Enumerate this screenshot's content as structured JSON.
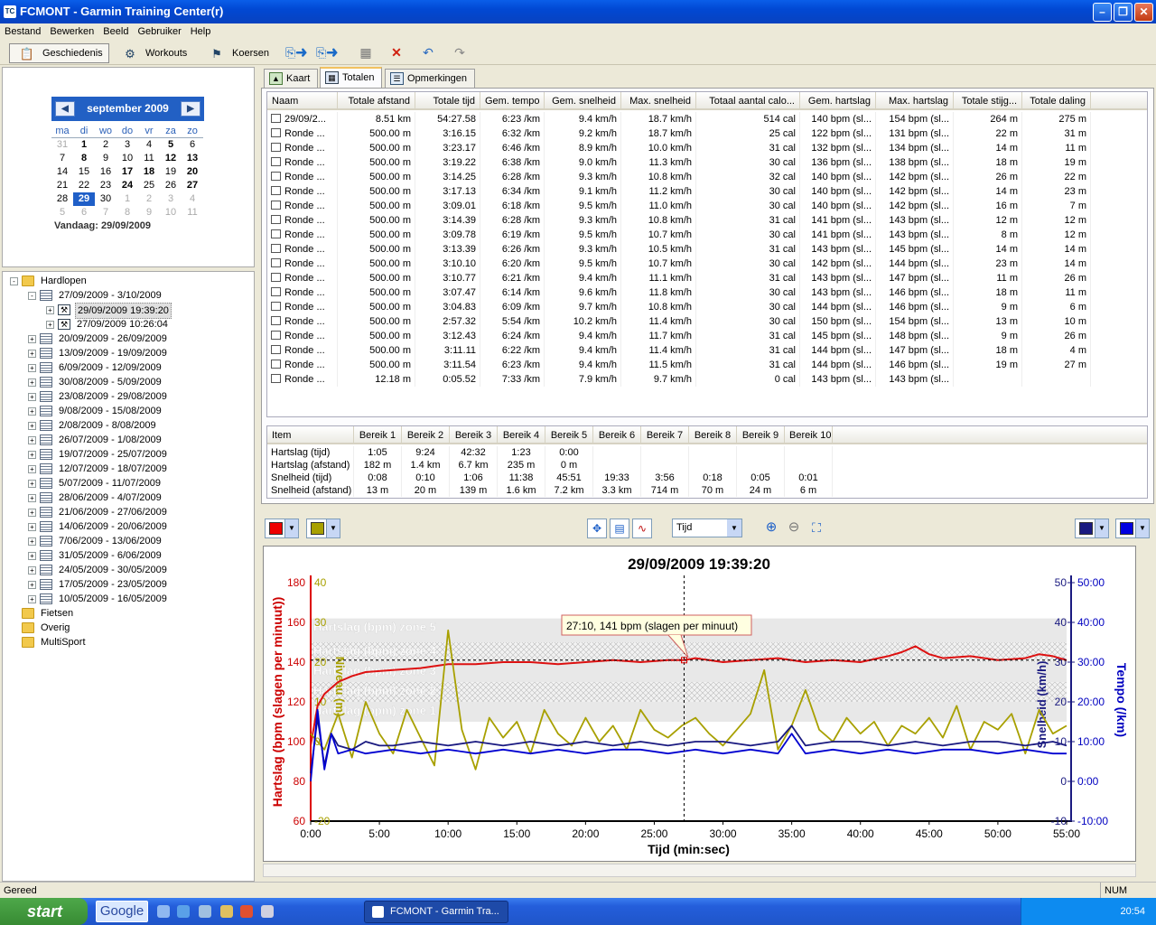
{
  "window": {
    "title": "FCMONT - Garmin Training Center(r)",
    "app_icon": "TC"
  },
  "menu": [
    "Bestand",
    "Bewerken",
    "Beeld",
    "Gebruiker",
    "Help"
  ],
  "toolbar": {
    "geschiedenis": "Geschiedenis",
    "workouts": "Workouts",
    "koersen": "Koersen"
  },
  "calendar": {
    "month": "september 2009",
    "weekdays": [
      "ma",
      "di",
      "wo",
      "do",
      "vr",
      "za",
      "zo"
    ],
    "weeks": [
      [
        "31",
        "1",
        "2",
        "3",
        "4",
        "5",
        "6"
      ],
      [
        "7",
        "8",
        "9",
        "10",
        "11",
        "12",
        "13"
      ],
      [
        "14",
        "15",
        "16",
        "17",
        "18",
        "19",
        "20"
      ],
      [
        "21",
        "22",
        "23",
        "24",
        "25",
        "26",
        "27"
      ],
      [
        "28",
        "29",
        "30",
        "1",
        "2",
        "3",
        "4"
      ],
      [
        "5",
        "6",
        "7",
        "8",
        "9",
        "10",
        "11"
      ]
    ],
    "today": "Vandaag: 29/09/2009"
  },
  "tree": [
    {
      "label": "Hardlopen",
      "level": 0,
      "type": "folder",
      "exp": "-"
    },
    {
      "label": "27/09/2009 - 3/10/2009",
      "level": 1,
      "type": "week",
      "exp": "-"
    },
    {
      "label": "29/09/2009 19:39:20",
      "level": 2,
      "type": "act",
      "exp": "+",
      "selected": true
    },
    {
      "label": "27/09/2009 10:26:04",
      "level": 2,
      "type": "act",
      "exp": "+"
    },
    {
      "label": "20/09/2009 - 26/09/2009",
      "level": 1,
      "type": "week",
      "exp": "+"
    },
    {
      "label": "13/09/2009 - 19/09/2009",
      "level": 1,
      "type": "week",
      "exp": "+"
    },
    {
      "label": "6/09/2009 - 12/09/2009",
      "level": 1,
      "type": "week",
      "exp": "+"
    },
    {
      "label": "30/08/2009 - 5/09/2009",
      "level": 1,
      "type": "week",
      "exp": "+"
    },
    {
      "label": "23/08/2009 - 29/08/2009",
      "level": 1,
      "type": "week",
      "exp": "+"
    },
    {
      "label": "9/08/2009 - 15/08/2009",
      "level": 1,
      "type": "week",
      "exp": "+"
    },
    {
      "label": "2/08/2009 - 8/08/2009",
      "level": 1,
      "type": "week",
      "exp": "+"
    },
    {
      "label": "26/07/2009 - 1/08/2009",
      "level": 1,
      "type": "week",
      "exp": "+"
    },
    {
      "label": "19/07/2009 - 25/07/2009",
      "level": 1,
      "type": "week",
      "exp": "+"
    },
    {
      "label": "12/07/2009 - 18/07/2009",
      "level": 1,
      "type": "week",
      "exp": "+"
    },
    {
      "label": "5/07/2009 - 11/07/2009",
      "level": 1,
      "type": "week",
      "exp": "+"
    },
    {
      "label": "28/06/2009 - 4/07/2009",
      "level": 1,
      "type": "week",
      "exp": "+"
    },
    {
      "label": "21/06/2009 - 27/06/2009",
      "level": 1,
      "type": "week",
      "exp": "+"
    },
    {
      "label": "14/06/2009 - 20/06/2009",
      "level": 1,
      "type": "week",
      "exp": "+"
    },
    {
      "label": "7/06/2009 - 13/06/2009",
      "level": 1,
      "type": "week",
      "exp": "+"
    },
    {
      "label": "31/05/2009 - 6/06/2009",
      "level": 1,
      "type": "week",
      "exp": "+"
    },
    {
      "label": "24/05/2009 - 30/05/2009",
      "level": 1,
      "type": "week",
      "exp": "+"
    },
    {
      "label": "17/05/2009 - 23/05/2009",
      "level": 1,
      "type": "week",
      "exp": "+"
    },
    {
      "label": "10/05/2009 - 16/05/2009",
      "level": 1,
      "type": "week",
      "exp": "+"
    },
    {
      "label": "Fietsen",
      "level": 0,
      "type": "folder",
      "exp": ""
    },
    {
      "label": "Overig",
      "level": 0,
      "type": "folder",
      "exp": ""
    },
    {
      "label": "MultiSport",
      "level": 0,
      "type": "folder",
      "exp": ""
    }
  ],
  "tabs": [
    "Kaart",
    "Totalen",
    "Opmerkingen"
  ],
  "laps": {
    "columns": [
      "Naam",
      "Totale afstand",
      "Totale tijd",
      "Gem. tempo",
      "Gem. snelheid",
      "Max. snelheid",
      "Totaal aantal calo...",
      "Gem. hartslag",
      "Max. hartslag",
      "Totale stijg...",
      "Totale daling"
    ],
    "rows": [
      [
        "29/09/2...",
        "8.51 km",
        "54:27.58",
        "6:23 /km",
        "9.4 km/h",
        "18.7 km/h",
        "514 cal",
        "140 bpm (sl...",
        "154 bpm (sl...",
        "264 m",
        "275 m"
      ],
      [
        "Ronde ...",
        "500.00 m",
        "3:16.15",
        "6:32 /km",
        "9.2 km/h",
        "18.7 km/h",
        "25 cal",
        "122 bpm (sl...",
        "131 bpm (sl...",
        "22 m",
        "31 m"
      ],
      [
        "Ronde ...",
        "500.00 m",
        "3:23.17",
        "6:46 /km",
        "8.9 km/h",
        "10.0 km/h",
        "31 cal",
        "132 bpm (sl...",
        "134 bpm (sl...",
        "14 m",
        "11 m"
      ],
      [
        "Ronde ...",
        "500.00 m",
        "3:19.22",
        "6:38 /km",
        "9.0 km/h",
        "11.3 km/h",
        "30 cal",
        "136 bpm (sl...",
        "138 bpm (sl...",
        "18 m",
        "19 m"
      ],
      [
        "Ronde ...",
        "500.00 m",
        "3:14.25",
        "6:28 /km",
        "9.3 km/h",
        "10.8 km/h",
        "32 cal",
        "140 bpm (sl...",
        "142 bpm (sl...",
        "26 m",
        "22 m"
      ],
      [
        "Ronde ...",
        "500.00 m",
        "3:17.13",
        "6:34 /km",
        "9.1 km/h",
        "11.2 km/h",
        "30 cal",
        "140 bpm (sl...",
        "142 bpm (sl...",
        "14 m",
        "23 m"
      ],
      [
        "Ronde ...",
        "500.00 m",
        "3:09.01",
        "6:18 /km",
        "9.5 km/h",
        "11.0 km/h",
        "30 cal",
        "140 bpm (sl...",
        "142 bpm (sl...",
        "16 m",
        "7 m"
      ],
      [
        "Ronde ...",
        "500.00 m",
        "3:14.39",
        "6:28 /km",
        "9.3 km/h",
        "10.8 km/h",
        "31 cal",
        "141 bpm (sl...",
        "143 bpm (sl...",
        "12 m",
        "12 m"
      ],
      [
        "Ronde ...",
        "500.00 m",
        "3:09.78",
        "6:19 /km",
        "9.5 km/h",
        "10.7 km/h",
        "30 cal",
        "141 bpm (sl...",
        "143 bpm (sl...",
        "8 m",
        "12 m"
      ],
      [
        "Ronde ...",
        "500.00 m",
        "3:13.39",
        "6:26 /km",
        "9.3 km/h",
        "10.5 km/h",
        "31 cal",
        "143 bpm (sl...",
        "145 bpm (sl...",
        "14 m",
        "14 m"
      ],
      [
        "Ronde ...",
        "500.00 m",
        "3:10.10",
        "6:20 /km",
        "9.5 km/h",
        "10.7 km/h",
        "30 cal",
        "142 bpm (sl...",
        "144 bpm (sl...",
        "23 m",
        "14 m"
      ],
      [
        "Ronde ...",
        "500.00 m",
        "3:10.77",
        "6:21 /km",
        "9.4 km/h",
        "11.1 km/h",
        "31 cal",
        "143 bpm (sl...",
        "147 bpm (sl...",
        "11 m",
        "26 m"
      ],
      [
        "Ronde ...",
        "500.00 m",
        "3:07.47",
        "6:14 /km",
        "9.6 km/h",
        "11.8 km/h",
        "30 cal",
        "143 bpm (sl...",
        "146 bpm (sl...",
        "18 m",
        "11 m"
      ],
      [
        "Ronde ...",
        "500.00 m",
        "3:04.83",
        "6:09 /km",
        "9.7 km/h",
        "10.8 km/h",
        "30 cal",
        "144 bpm (sl...",
        "146 bpm (sl...",
        "9 m",
        "6 m"
      ],
      [
        "Ronde ...",
        "500.00 m",
        "2:57.32",
        "5:54 /km",
        "10.2 km/h",
        "11.4 km/h",
        "30 cal",
        "150 bpm (sl...",
        "154 bpm (sl...",
        "13 m",
        "10 m"
      ],
      [
        "Ronde ...",
        "500.00 m",
        "3:12.43",
        "6:24 /km",
        "9.4 km/h",
        "11.7 km/h",
        "31 cal",
        "145 bpm (sl...",
        "148 bpm (sl...",
        "9 m",
        "26 m"
      ],
      [
        "Ronde ...",
        "500.00 m",
        "3:11.11",
        "6:22 /km",
        "9.4 km/h",
        "11.4 km/h",
        "31 cal",
        "144 bpm (sl...",
        "147 bpm (sl...",
        "18 m",
        "4 m"
      ],
      [
        "Ronde ...",
        "500.00 m",
        "3:11.54",
        "6:23 /km",
        "9.4 km/h",
        "11.5 km/h",
        "31 cal",
        "144 bpm (sl...",
        "146 bpm (sl...",
        "19 m",
        "27 m"
      ],
      [
        "Ronde ...",
        "12.18 m",
        "0:05.52",
        "7:33 /km",
        "7.9 km/h",
        "9.7 km/h",
        "0 cal",
        "143 bpm (sl...",
        "143 bpm (sl...",
        "",
        ""
      ]
    ]
  },
  "zones": {
    "columns": [
      "Item",
      "Bereik 1",
      "Bereik 2",
      "Bereik 3",
      "Bereik 4",
      "Bereik 5",
      "Bereik 6",
      "Bereik 7",
      "Bereik 8",
      "Bereik 9",
      "Bereik 10"
    ],
    "rows": [
      [
        "Hartslag (tijd)",
        "1:05",
        "9:24",
        "42:32",
        "1:23",
        "0:00",
        "",
        "",
        "",
        "",
        ""
      ],
      [
        "Hartslag (afstand)",
        "182 m",
        "1.4 km",
        "6.7 km",
        "235 m",
        "0 m",
        "",
        "",
        "",
        "",
        ""
      ],
      [
        "Snelheid (tijd)",
        "0:08",
        "0:10",
        "1:06",
        "11:38",
        "45:51",
        "19:33",
        "3:56",
        "0:18",
        "0:05",
        "0:01"
      ],
      [
        "Snelheid (afstand)",
        "13 m",
        "20 m",
        "139 m",
        "1.6 km",
        "7.2 km",
        "3.3 km",
        "714 m",
        "70 m",
        "24 m",
        "6 m"
      ]
    ]
  },
  "chart_controls": {
    "x_axis_select": "Tijd",
    "colors": [
      "#ee0000",
      "#a8a000",
      "#1a1a80",
      "#0000e0"
    ]
  },
  "chart_data": {
    "type": "line",
    "title": "29/09/2009 19:39:20",
    "xlabel": "Tijd (min:sec)",
    "xlim": [
      0,
      55
    ],
    "x_ticks": [
      "0:00",
      "5:00",
      "10:00",
      "15:00",
      "20:00",
      "25:00",
      "30:00",
      "35:00",
      "40:00",
      "45:00",
      "50:00",
      "55:00"
    ],
    "axes": {
      "left1": {
        "label": "Hartslag (bpm (slagen per minuut))",
        "min": 60,
        "max": 180,
        "ticks": [
          "60",
          "80",
          "100",
          "120",
          "140",
          "160",
          "180"
        ],
        "color": "#cc0000"
      },
      "left2": {
        "label": "Niveau (m)",
        "min": -20,
        "max": 40,
        "ticks": [
          "-20",
          "0",
          "10",
          "20",
          "30",
          "40"
        ],
        "color": "#a8a000"
      },
      "right1": {
        "label": "Snelheid (km/h)",
        "min": -10,
        "max": 50,
        "ticks": [
          "-10",
          "0",
          "10",
          "20",
          "30",
          "40",
          "50"
        ],
        "color": "#1a1a80"
      },
      "right2": {
        "label": "Tempo (/km)",
        "ticks": [
          "-10:00",
          "0:00",
          "10:00",
          "20:00",
          "30:00",
          "40:00",
          "50:00"
        ],
        "color": "#0000c0"
      }
    },
    "zones": [
      {
        "label": "Hartslag (bpm) zone 5",
        "lo": 150,
        "hi": 162
      },
      {
        "label": "Hartslag (bpm) zone 4",
        "lo": 140,
        "hi": 150
      },
      {
        "label": "Hartslag (bpm) zone 3",
        "lo": 130,
        "hi": 140
      },
      {
        "label": "Hartslag (bpm) zone 2",
        "lo": 120,
        "hi": 130
      },
      {
        "label": "Hartslag (bpm) zone 1",
        "lo": 110,
        "hi": 120
      }
    ],
    "tooltip": {
      "text": "27:10, 141 bpm (slagen per minuut)",
      "x": 27.17,
      "y": 141
    },
    "series": [
      {
        "name": "Hartslag",
        "axis": "left1",
        "color": "#dd1111",
        "x": [
          0,
          0.5,
          1,
          2,
          3,
          4,
          6,
          8,
          10,
          12,
          14,
          16,
          18,
          20,
          22,
          24,
          26,
          27.17,
          28,
          30,
          32,
          34,
          36,
          38,
          40,
          42,
          43,
          44,
          45,
          46,
          48,
          50,
          52,
          53,
          54,
          55
        ],
        "y": [
          98,
          118,
          124,
          130,
          133,
          135,
          136,
          137,
          139,
          139,
          140,
          140,
          139,
          140,
          141,
          140,
          141,
          141,
          142,
          140,
          141,
          142,
          140,
          141,
          140,
          143,
          145,
          148,
          144,
          142,
          143,
          141,
          142,
          144,
          143,
          141
        ]
      },
      {
        "name": "Niveau",
        "axis": "left2",
        "color": "#a8a000",
        "x": [
          0,
          1,
          2,
          3,
          4,
          5,
          6,
          7,
          8,
          9,
          10,
          11,
          12,
          13,
          14,
          15,
          16,
          17,
          18,
          19,
          20,
          21,
          22,
          23,
          24,
          25,
          26,
          27,
          28,
          29,
          30,
          31,
          32,
          33,
          34,
          35,
          36,
          37,
          38,
          39,
          40,
          41,
          42,
          43,
          44,
          45,
          46,
          47,
          48,
          49,
          50,
          51,
          52,
          53,
          54,
          55
        ],
        "y": [
          2,
          -2,
          7,
          -4,
          10,
          2,
          -3,
          8,
          1,
          -6,
          28,
          3,
          -7,
          6,
          1,
          5,
          -3,
          8,
          2,
          -1,
          6,
          0,
          4,
          -2,
          8,
          3,
          1,
          4,
          6,
          2,
          -1,
          3,
          7,
          18,
          -2,
          4,
          13,
          3,
          0,
          6,
          2,
          5,
          -1,
          4,
          2,
          6,
          1,
          9,
          -2,
          5,
          3,
          7,
          -3,
          8,
          2,
          4
        ]
      },
      {
        "name": "Snelheid",
        "axis": "right1",
        "color": "#1a1a80",
        "x": [
          0,
          0.5,
          1,
          1.5,
          2,
          3,
          4,
          5,
          6,
          8,
          10,
          12,
          14,
          16,
          18,
          20,
          22,
          24,
          26,
          28,
          30,
          32,
          34,
          35,
          36,
          38,
          40,
          42,
          44,
          46,
          48,
          50,
          52,
          54,
          55
        ],
        "y": [
          2,
          16,
          4,
          12,
          9,
          8,
          10,
          9,
          9,
          10,
          9,
          10,
          9,
          10,
          9,
          10,
          9,
          10,
          9,
          10,
          10,
          9,
          10,
          14,
          9,
          10,
          10,
          9,
          10,
          9,
          10,
          10,
          9,
          10,
          9
        ]
      },
      {
        "name": "Tempo",
        "axis": "right1",
        "color": "#0000d0",
        "x": [
          0,
          0.5,
          1,
          1.5,
          2,
          3,
          4,
          6,
          8,
          10,
          12,
          14,
          16,
          18,
          20,
          22,
          24,
          26,
          28,
          30,
          32,
          34,
          35,
          36,
          38,
          40,
          42,
          44,
          46,
          48,
          50,
          52,
          54,
          55
        ],
        "y": [
          0,
          18,
          3,
          12,
          7,
          8,
          7,
          8,
          7,
          8,
          7,
          8,
          7,
          8,
          7,
          8,
          8,
          7,
          8,
          7,
          8,
          7,
          12,
          7,
          8,
          7,
          8,
          7,
          8,
          8,
          7,
          8,
          7,
          7
        ]
      }
    ]
  },
  "status": {
    "left": "Gereed",
    "num": "NUM"
  },
  "taskbar": {
    "start": "start",
    "google": "Google",
    "app": "FCMONT - Garmin Tra...",
    "clock": "20:54"
  }
}
